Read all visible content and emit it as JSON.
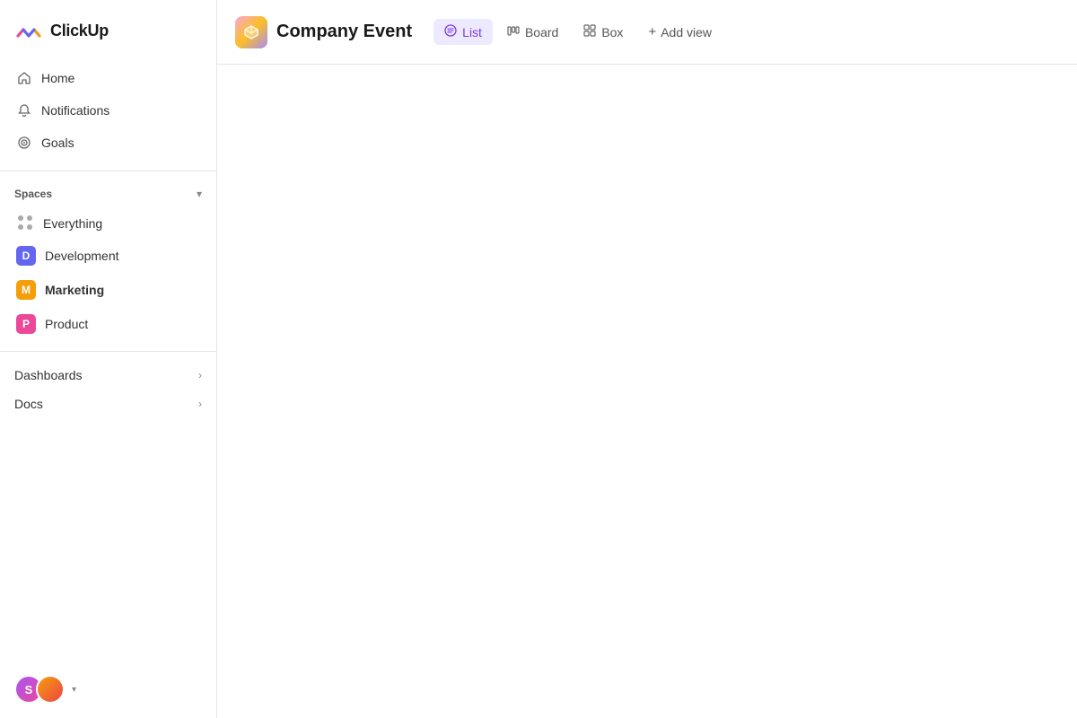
{
  "app": {
    "name": "ClickUp"
  },
  "sidebar": {
    "nav": [
      {
        "id": "home",
        "label": "Home",
        "icon": "🏠"
      },
      {
        "id": "notifications",
        "label": "Notifications",
        "icon": "🔔"
      },
      {
        "id": "goals",
        "label": "Goals",
        "icon": "🎯"
      }
    ],
    "spaces_label": "Spaces",
    "spaces": [
      {
        "id": "everything",
        "label": "Everything",
        "type": "dots"
      },
      {
        "id": "development",
        "label": "Development",
        "type": "avatar",
        "color": "#6366f1",
        "letter": "D"
      },
      {
        "id": "marketing",
        "label": "Marketing",
        "type": "avatar",
        "color": "#f59e0b",
        "letter": "M",
        "active": true
      },
      {
        "id": "product",
        "label": "Product",
        "type": "avatar",
        "color": "#ec4899",
        "letter": "P"
      }
    ],
    "expandable": [
      {
        "id": "dashboards",
        "label": "Dashboards"
      },
      {
        "id": "docs",
        "label": "Docs"
      }
    ]
  },
  "topbar": {
    "project_title": "Company Event",
    "views": [
      {
        "id": "list",
        "label": "List",
        "active": true,
        "icon": "list"
      },
      {
        "id": "board",
        "label": "Board",
        "active": false,
        "icon": "board"
      },
      {
        "id": "box",
        "label": "Box",
        "active": false,
        "icon": "box"
      }
    ],
    "add_view_label": "Add view"
  }
}
